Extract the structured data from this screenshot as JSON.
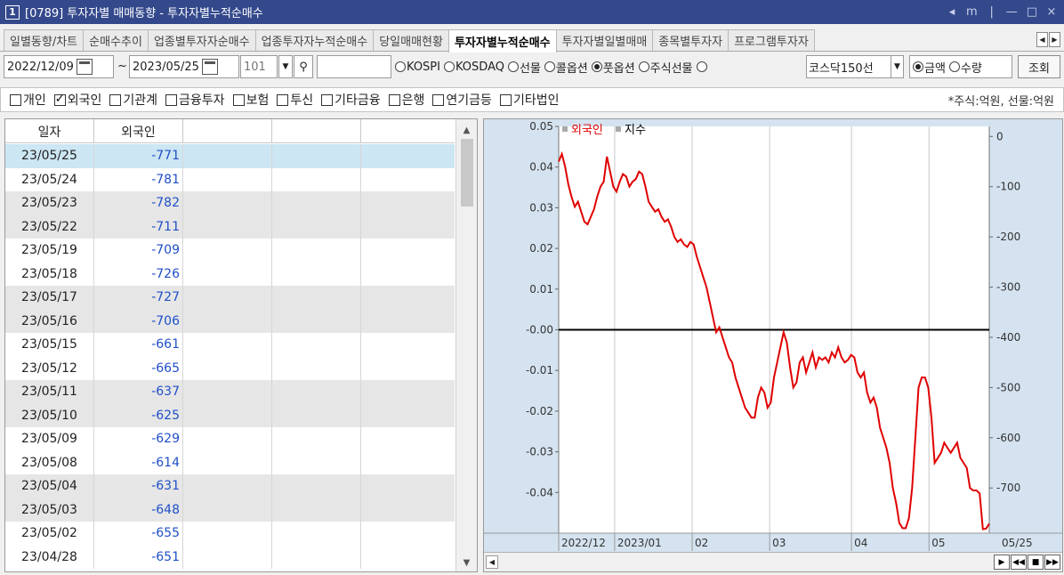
{
  "window": {
    "number": "1",
    "title": "[0789] 투자자별 매매동향 - 투자자별누적순매수",
    "controls": [
      "◂",
      "m",
      "|",
      "—",
      "□",
      "×"
    ]
  },
  "tabs": [
    {
      "label": "일별동향/차트",
      "active": false
    },
    {
      "label": "순매수추이",
      "active": false
    },
    {
      "label": "업종별투자자순매수",
      "active": false
    },
    {
      "label": "업종투자자누적순매수",
      "active": false
    },
    {
      "label": "당일매매현황",
      "active": false
    },
    {
      "label": "투자자별누적순매수",
      "active": true
    },
    {
      "label": "투자자별일별매매",
      "active": false
    },
    {
      "label": "종목별투자자",
      "active": false
    },
    {
      "label": "프로그램투자자",
      "active": false
    }
  ],
  "controls": {
    "start_date": "2022/12/09",
    "tilde": "~",
    "end_date": "2023/05/25",
    "code": "101",
    "search_value": "",
    "market_radios": [
      {
        "label": "KOSPI",
        "selected": false
      },
      {
        "label": "KOSDAQ",
        "selected": false
      },
      {
        "label": "선물",
        "selected": false
      },
      {
        "label": "콜옵션",
        "selected": false
      },
      {
        "label": "풋옵션",
        "selected": true
      },
      {
        "label": "주식선물",
        "selected": false
      },
      {
        "label": "",
        "selected": false
      }
    ],
    "index_select": "코스닥150선",
    "unit_radios": [
      {
        "label": "금액",
        "selected": true
      },
      {
        "label": "수량",
        "selected": false
      }
    ],
    "query_button": "조회"
  },
  "filters": {
    "items": [
      {
        "label": "개인",
        "checked": false
      },
      {
        "label": "외국인",
        "checked": true
      },
      {
        "label": "기관계",
        "checked": false
      },
      {
        "label": "금융투자",
        "checked": false
      },
      {
        "label": "보험",
        "checked": false
      },
      {
        "label": "투신",
        "checked": false
      },
      {
        "label": "기타금융",
        "checked": false
      },
      {
        "label": "은행",
        "checked": false
      },
      {
        "label": "연기금등",
        "checked": false
      },
      {
        "label": "기타법인",
        "checked": false
      }
    ],
    "unit_note": "*주식:억원, 선물:억원"
  },
  "grid": {
    "headers": [
      "일자",
      "외국인",
      "",
      "",
      ""
    ],
    "rows": [
      {
        "date": "23/05/25",
        "value": "-771"
      },
      {
        "date": "23/05/24",
        "value": "-781"
      },
      {
        "date": "23/05/23",
        "value": "-782"
      },
      {
        "date": "23/05/22",
        "value": "-711"
      },
      {
        "date": "23/05/19",
        "value": "-709"
      },
      {
        "date": "23/05/18",
        "value": "-726"
      },
      {
        "date": "23/05/17",
        "value": "-727"
      },
      {
        "date": "23/05/16",
        "value": "-706"
      },
      {
        "date": "23/05/15",
        "value": "-661"
      },
      {
        "date": "23/05/12",
        "value": "-665"
      },
      {
        "date": "23/05/11",
        "value": "-637"
      },
      {
        "date": "23/05/10",
        "value": "-625"
      },
      {
        "date": "23/05/09",
        "value": "-629"
      },
      {
        "date": "23/05/08",
        "value": "-614"
      },
      {
        "date": "23/05/04",
        "value": "-631"
      },
      {
        "date": "23/05/03",
        "value": "-648"
      },
      {
        "date": "23/05/02",
        "value": "-655"
      },
      {
        "date": "23/04/28",
        "value": "-651"
      }
    ]
  },
  "chart_data": {
    "type": "line",
    "legend": [
      {
        "name": "외국인",
        "color": "#e00000"
      },
      {
        "name": "지수",
        "color": "#000000"
      }
    ],
    "y_left_ticks": [
      "0.05",
      "0.04",
      "0.03",
      "0.02",
      "0.01",
      "-0.00",
      "-0.01",
      "-0.02",
      "-0.03",
      "-0.04"
    ],
    "y_left_range": [
      -0.05,
      0.05
    ],
    "y_right_ticks": [
      "0",
      "-100",
      "-200",
      "-300",
      "-400",
      "-500",
      "-600",
      "-700"
    ],
    "y_right_range": [
      20,
      -790
    ],
    "x_labels": [
      "2022/12",
      "2023/01",
      "02",
      "03",
      "04",
      "05"
    ],
    "x_end_label": "05/25",
    "zero_line_value": 0,
    "series": [
      {
        "name": "외국인",
        "color": "#e00000",
        "axis": "right",
        "values": [
          -50,
          -35,
          -60,
          -95,
          -120,
          -140,
          -130,
          -150,
          -170,
          -175,
          -160,
          -145,
          -120,
          -100,
          -90,
          -40,
          -70,
          -100,
          -110,
          -90,
          -75,
          -80,
          -100,
          -90,
          -85,
          -70,
          -75,
          -100,
          -130,
          -140,
          -150,
          -145,
          -160,
          -170,
          -165,
          -180,
          -200,
          -210,
          -205,
          -215,
          -220,
          -210,
          -215,
          -240,
          -260,
          -280,
          -300,
          -330,
          -360,
          -390,
          -380,
          -400,
          -420,
          -440,
          -450,
          -480,
          -500,
          -520,
          -540,
          -550,
          -560,
          -560,
          -520,
          -500,
          -510,
          -540,
          -530,
          -480,
          -450,
          -420,
          -390,
          -410,
          -460,
          -500,
          -490,
          -450,
          -440,
          -470,
          -450,
          -430,
          -460,
          -440,
          -445,
          -440,
          -450,
          -430,
          -440,
          -420,
          -440,
          -450,
          -445,
          -435,
          -440,
          -470,
          -480,
          -470,
          -510,
          -530,
          -520,
          -540,
          -580,
          -600,
          -620,
          -650,
          -700,
          -730,
          -770,
          -780,
          -780,
          -760,
          -700,
          -600,
          -500,
          -480,
          -480,
          -500,
          -560,
          -650,
          -640,
          -630,
          -610,
          -620,
          -630,
          -620,
          -610,
          -640,
          -650,
          -660,
          -700,
          -705,
          -705,
          -711,
          -782,
          -781,
          -771
        ]
      }
    ]
  }
}
